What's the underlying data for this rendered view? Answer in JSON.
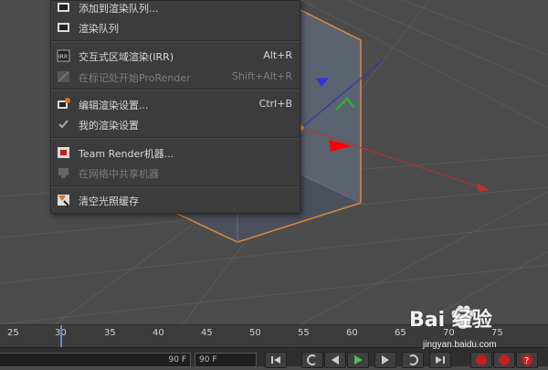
{
  "menu": {
    "items": [
      {
        "label": "添加到渲染队列...",
        "shortcut": "",
        "enabled": true,
        "icon": "render-queue-add-icon"
      },
      {
        "label": "渲染队列",
        "shortcut": "",
        "enabled": true,
        "icon": "render-queue-icon"
      },
      {
        "label": "交互式区域渲染(IRR)",
        "shortcut": "Alt+R",
        "enabled": true,
        "icon": "irr-icon"
      },
      {
        "label": "在标记处开始ProRender",
        "shortcut": "Shift+Alt+R",
        "enabled": false,
        "icon": "prorender-icon"
      },
      {
        "label": "编辑渲染设置...",
        "shortcut": "Ctrl+B",
        "enabled": true,
        "icon": "render-settings-icon"
      },
      {
        "label": "我的渲染设置",
        "shortcut": "",
        "enabled": true,
        "icon": "checkmark-icon"
      },
      {
        "label": "Team Render机器...",
        "shortcut": "",
        "enabled": true,
        "icon": "team-render-icon"
      },
      {
        "label": "在网络中共享机器",
        "shortcut": "",
        "enabled": false,
        "icon": "share-machine-icon"
      },
      {
        "label": "清空光照缓存",
        "shortcut": "",
        "enabled": true,
        "icon": "clear-cache-icon"
      }
    ]
  },
  "timeline": {
    "ticks": [
      "25",
      "30",
      "35",
      "40",
      "45",
      "50",
      "55",
      "60",
      "65",
      "70",
      "75"
    ],
    "current_frame": "30"
  },
  "transport": {
    "frame_field_1": "90 F",
    "frame_field_2": "90 F"
  },
  "watermark": {
    "brand": "Bai 经验",
    "url": "jingyan.baidu.com"
  },
  "colors": {
    "viewport_bg": "#4c4c4c",
    "cube_edge": "#e08a3a",
    "axis_x": "#e02020",
    "axis_y": "#20c020",
    "axis_z": "#2020e0",
    "menu_bg": "#3c3c3c",
    "annotation_arrow": "#ff0000"
  }
}
